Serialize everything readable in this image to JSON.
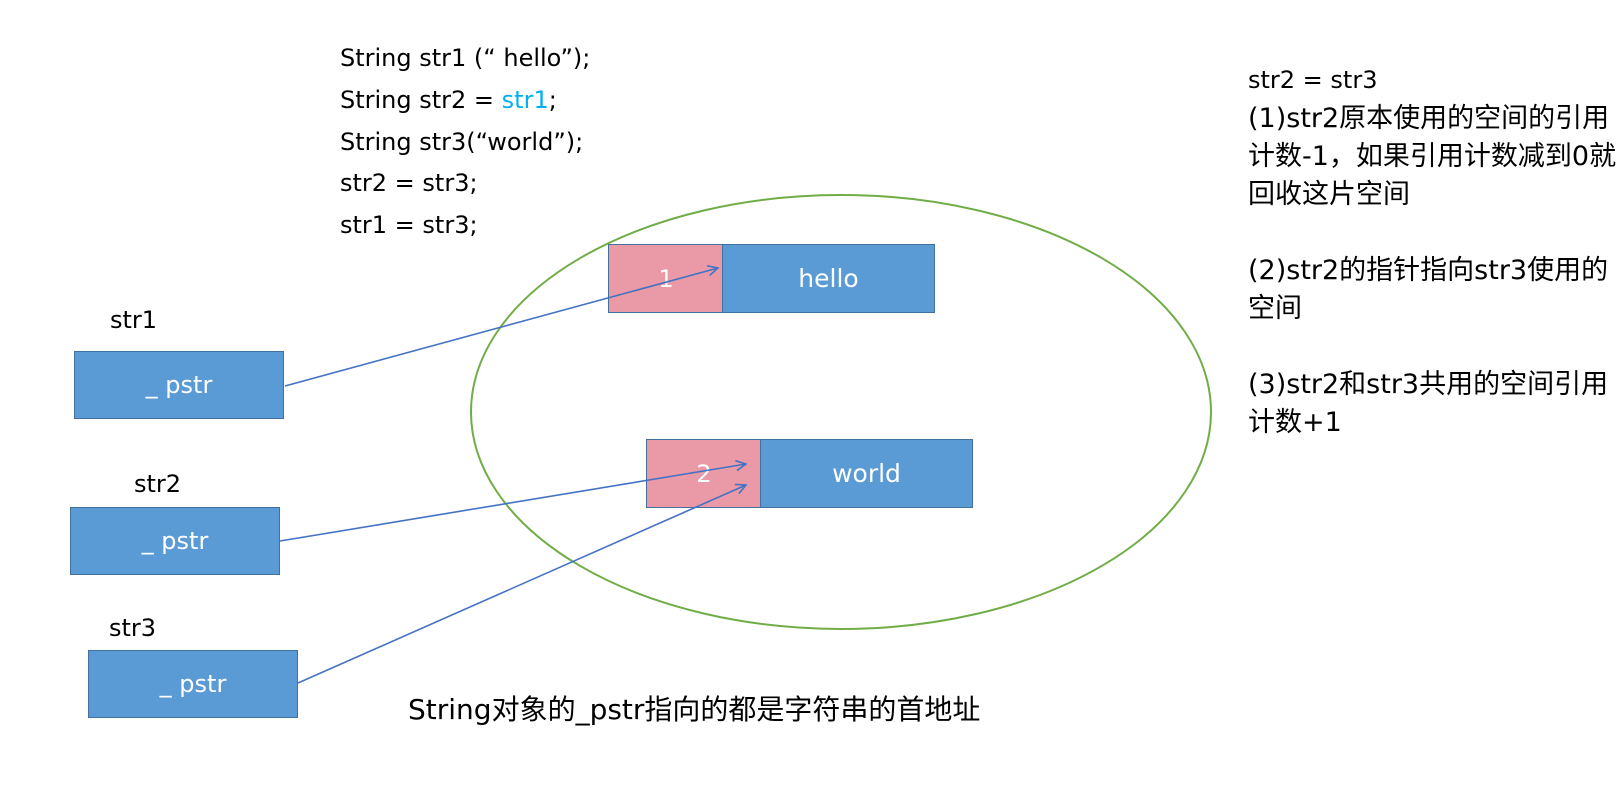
{
  "code": {
    "lines": [
      {
        "pre": "String str1 (“ hello”);",
        "highlight": "",
        "post": ""
      },
      {
        "pre": "String str2 = ",
        "highlight": "str1",
        "post": ";"
      },
      {
        "pre": "String str3(“world”);",
        "highlight": "",
        "post": ""
      },
      {
        "pre": "str2 = str3;",
        "highlight": "",
        "post": ""
      },
      {
        "pre": "str1 = str3;",
        "highlight": "",
        "post": ""
      }
    ],
    "highlight_color": "#00b0f0"
  },
  "objects": [
    {
      "label": "str1",
      "field": "_ pstr"
    },
    {
      "label": "str2",
      "field": "_ pstr"
    },
    {
      "label": "str3",
      "field": "_ pstr"
    }
  ],
  "heap": {
    "blocks": [
      {
        "count": "1",
        "text": "hello"
      },
      {
        "count": "2",
        "text": "world"
      }
    ],
    "ellipse_color": "#70ad47"
  },
  "notes": {
    "heading": "str2 = str3",
    "step1": "(1)str2原本使用的空间的引用计数-1，如果引用计数减到0就回收这片空间",
    "step2": "(2)str2的指针指向str3使用的空间",
    "step3": "(3)str2和str3共用的空间引用计数+1"
  },
  "caption": "String对象的_pstr指向的都是字符串的首地址",
  "colors": {
    "box_blue": "#5b9bd5",
    "count_pink": "#ea9aa6",
    "arrow_blue": "#4472c4"
  }
}
